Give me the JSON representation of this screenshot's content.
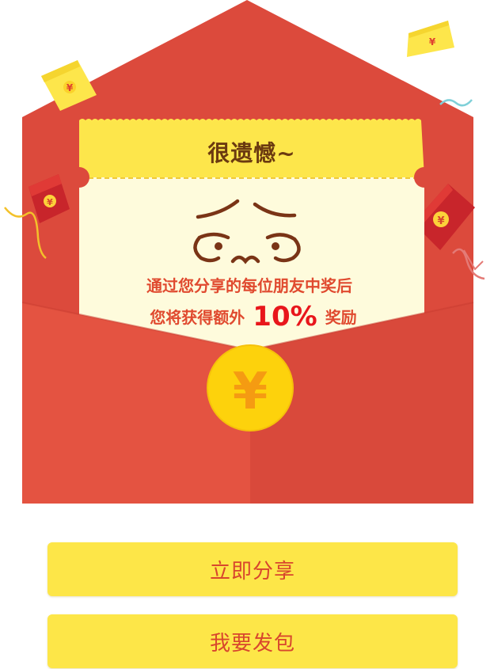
{
  "ticket": {
    "title": "很遗憾~"
  },
  "message": {
    "line1": "通过您分享的每位朋友中奖后",
    "line2_prefix": "您将获得额外",
    "line2_percent": "10%",
    "line2_suffix": "奖励"
  },
  "coin": {
    "symbol": "¥"
  },
  "decor_symbol": "¥",
  "buttons": {
    "share_label": "立即分享",
    "send_label": "我要发包"
  },
  "colors": {
    "envelope_red": "#dc4a3c",
    "envelope_front_left": "#e45341",
    "envelope_front_right": "#d9493b",
    "ticket_header_yellow": "#fde64b",
    "card_cream": "#fefbdc",
    "coin_yellow": "#fdd20c",
    "coin_symbol": "#f59b12",
    "button_yellow": "#fde648",
    "button_text": "#d8462d",
    "accent_red": "#e8161b"
  }
}
